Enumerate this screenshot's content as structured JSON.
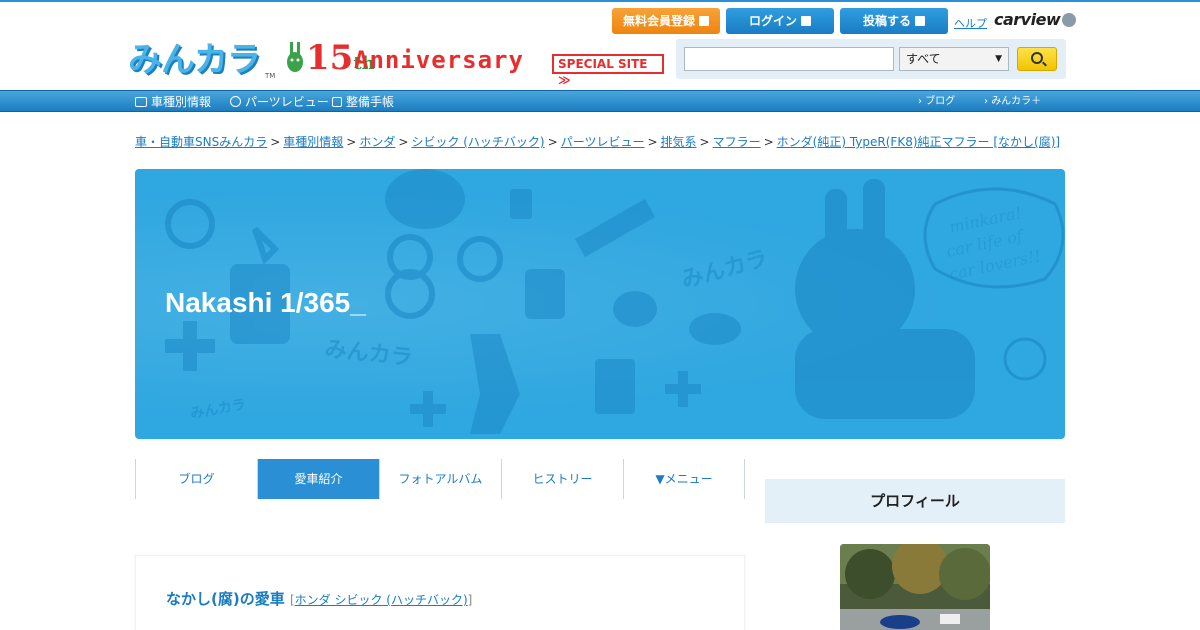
{
  "header": {
    "logo": "みんカラ",
    "logo_tm": "TM",
    "anniversary": {
      "number": "15",
      "suffix": "th",
      "word": "Anniversary",
      "special": "SPECIAL SITE ≫"
    },
    "buttons": {
      "register": "無料会員登録",
      "login": "ログイン",
      "post": "投稿する"
    },
    "help": "ヘルプ",
    "carview": "carview",
    "search": {
      "placeholder": "",
      "select_value": "すべて"
    }
  },
  "nav": {
    "left": [
      "車種別情報",
      "パーツレビュー",
      "整備手帳"
    ],
    "right": [
      "ブログ",
      "みんカラ＋"
    ]
  },
  "breadcrumb": [
    "車・自動車SNSみんカラ",
    "車種別情報",
    "ホンダ",
    "シビック (ハッチバック)",
    "パーツレビュー",
    "排気系",
    "マフラー",
    "ホンダ(純正) TypeR(FK8)純正マフラー [なかし(腐)]"
  ],
  "breadcrumb_sep": ">",
  "hero": {
    "title": "Nakashi 1/365_"
  },
  "tabs": [
    "ブログ",
    "愛車紹介",
    "フォトアルバム",
    "ヒストリー",
    "▼メニュー"
  ],
  "card": {
    "owner": "なかし(腐)の愛車",
    "model": "ホンダ シビック (ハッチバック)",
    "model_open": "[",
    "model_close": "]"
  },
  "sidebar": {
    "profile_heading": "プロフィール"
  },
  "colors": {
    "brand_blue": "#2a8fd4",
    "hero_blue": "#2fa7e0",
    "register_orange": "#ee8410",
    "search_yellow": "#f1c400"
  }
}
